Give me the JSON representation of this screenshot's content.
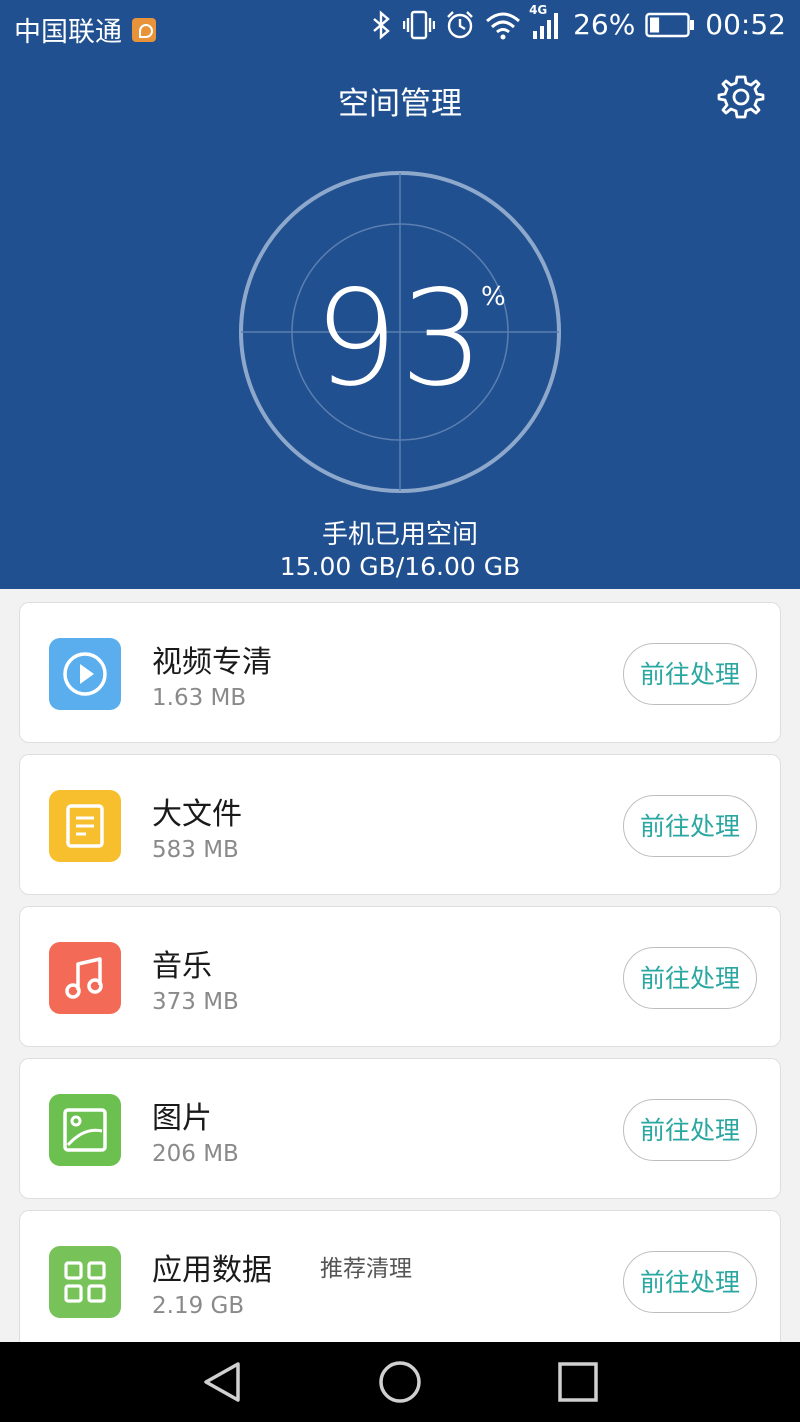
{
  "status_bar": {
    "carrier": "中国联通",
    "battery_percent_text": "26%",
    "battery_level": 0.26,
    "time": "00:52",
    "network_label": "4G",
    "icons": [
      "carrier-badge-icon",
      "bluetooth-icon",
      "vibrate-icon",
      "alarm-icon",
      "wifi-icon",
      "signal-icon",
      "battery-icon"
    ]
  },
  "header": {
    "title": "空间管理",
    "settings_icon": "gear-icon",
    "usage_percent": "93",
    "percent_sign": "%",
    "used_label": "手机已用空间",
    "used_value": "15.00 GB/16.00 GB"
  },
  "items": [
    {
      "name": "视频专清",
      "size": "1.63 MB",
      "tag": "",
      "action": "前往处理",
      "icon": "video-play-icon",
      "color": "#5aaeee"
    },
    {
      "name": "大文件",
      "size": "583 MB",
      "tag": "",
      "action": "前往处理",
      "icon": "document-icon",
      "color": "#f7bf2e"
    },
    {
      "name": "音乐",
      "size": "373 MB",
      "tag": "",
      "action": "前往处理",
      "icon": "music-note-icon",
      "color": "#f36b56"
    },
    {
      "name": "图片",
      "size": "206 MB",
      "tag": "",
      "action": "前往处理",
      "icon": "picture-icon",
      "color": "#6cc050"
    },
    {
      "name": "应用数据",
      "size": "2.19 GB",
      "tag": "推荐清理",
      "action": "前往处理",
      "icon": "apps-grid-icon",
      "color": "#78c25a"
    }
  ],
  "nav": {
    "icons": [
      "back-triangle-icon",
      "home-circle-icon",
      "recents-square-icon"
    ]
  },
  "colors": {
    "header_bg": "#215090",
    "action_text": "#2aa7a0",
    "page_bg": "#f2f2f2"
  }
}
